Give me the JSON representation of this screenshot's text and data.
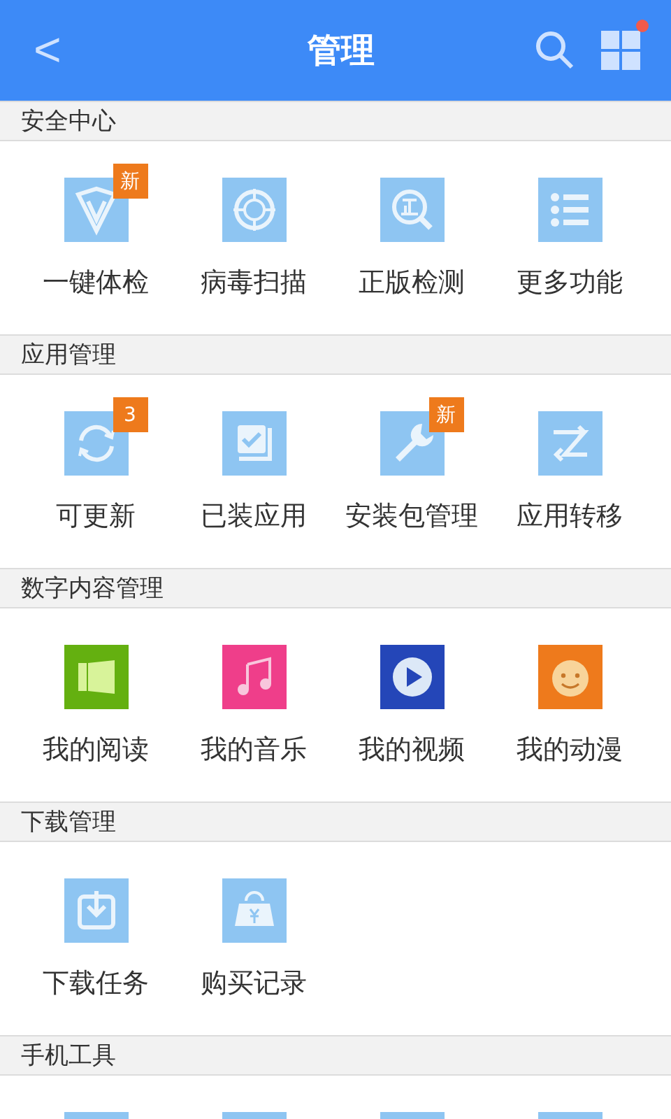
{
  "header": {
    "back": "<",
    "title": "管理",
    "notification_dot": true
  },
  "sections": [
    {
      "title": "安全中心",
      "items": [
        {
          "label": "一键体检",
          "badge": "新"
        },
        {
          "label": "病毒扫描"
        },
        {
          "label": "正版检测"
        },
        {
          "label": "更多功能"
        }
      ]
    },
    {
      "title": "应用管理",
      "items": [
        {
          "label": "可更新",
          "badge": "3"
        },
        {
          "label": "已装应用"
        },
        {
          "label": "安装包管理",
          "badge": "新"
        },
        {
          "label": "应用转移"
        }
      ]
    },
    {
      "title": "数字内容管理",
      "items": [
        {
          "label": "我的阅读"
        },
        {
          "label": "我的音乐"
        },
        {
          "label": "我的视频"
        },
        {
          "label": "我的动漫"
        }
      ]
    },
    {
      "title": "下载管理",
      "items": [
        {
          "label": "下载任务"
        },
        {
          "label": "购买记录"
        }
      ]
    },
    {
      "title": "手机工具",
      "items": [
        {
          "kind": "cut"
        },
        {
          "kind": "cut"
        },
        {
          "kind": "cut"
        },
        {
          "kind": "cut"
        }
      ]
    }
  ]
}
